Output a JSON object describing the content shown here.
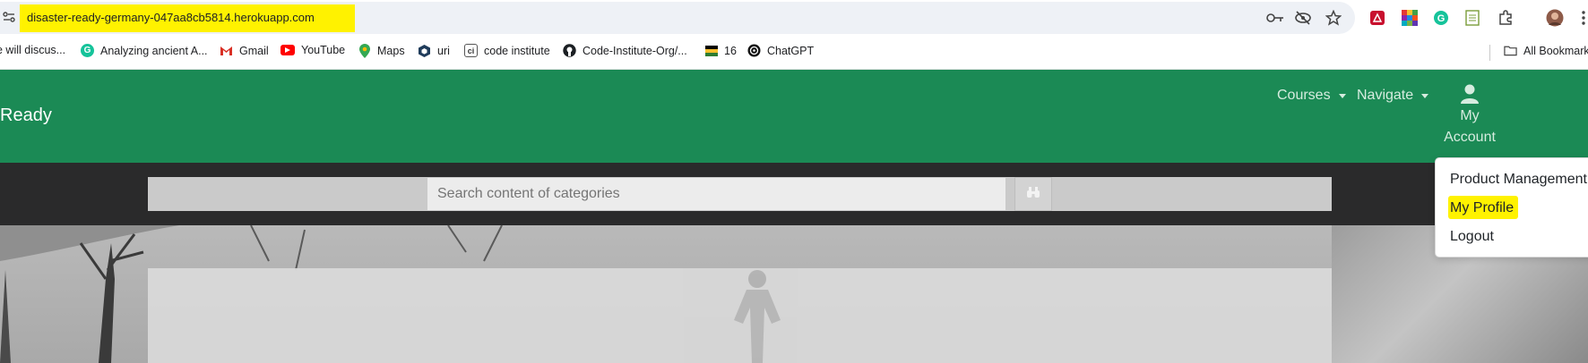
{
  "browser": {
    "url": "disaster-ready-germany-047aa8cb5814.herokuapp.com",
    "bookmarks": [
      {
        "label": "e will discus...",
        "icon": "generic-page-icon"
      },
      {
        "label": "Analyzing ancient A...",
        "icon": "grammarly-icon"
      },
      {
        "label": "Gmail",
        "icon": "gmail-icon"
      },
      {
        "label": "YouTube",
        "icon": "youtube-icon"
      },
      {
        "label": "Maps",
        "icon": "maps-icon"
      },
      {
        "label": "uri",
        "icon": "cube-icon"
      },
      {
        "label": "code institute",
        "icon": "code-institute-icon"
      },
      {
        "label": "Code-Institute-Org/...",
        "icon": "github-icon"
      },
      {
        "label": "16",
        "icon": "flag-icon"
      },
      {
        "label": "ChatGPT",
        "icon": "chatgpt-icon"
      }
    ],
    "all_bookmarks": "All Bookmark"
  },
  "site": {
    "brand": "Ready",
    "nav": {
      "courses": "Courses",
      "navigate": "Navigate",
      "account_line1": "My",
      "account_line2": "Account"
    },
    "search": {
      "placeholder": "Search content of categories"
    },
    "account_menu": {
      "items": [
        "Product Management",
        "My Profile",
        "Logout"
      ],
      "highlighted": "My Profile"
    }
  },
  "colors": {
    "header_green": "#1b8a55",
    "search_strip": "#2a2a2b",
    "highlight": "#fff200"
  }
}
